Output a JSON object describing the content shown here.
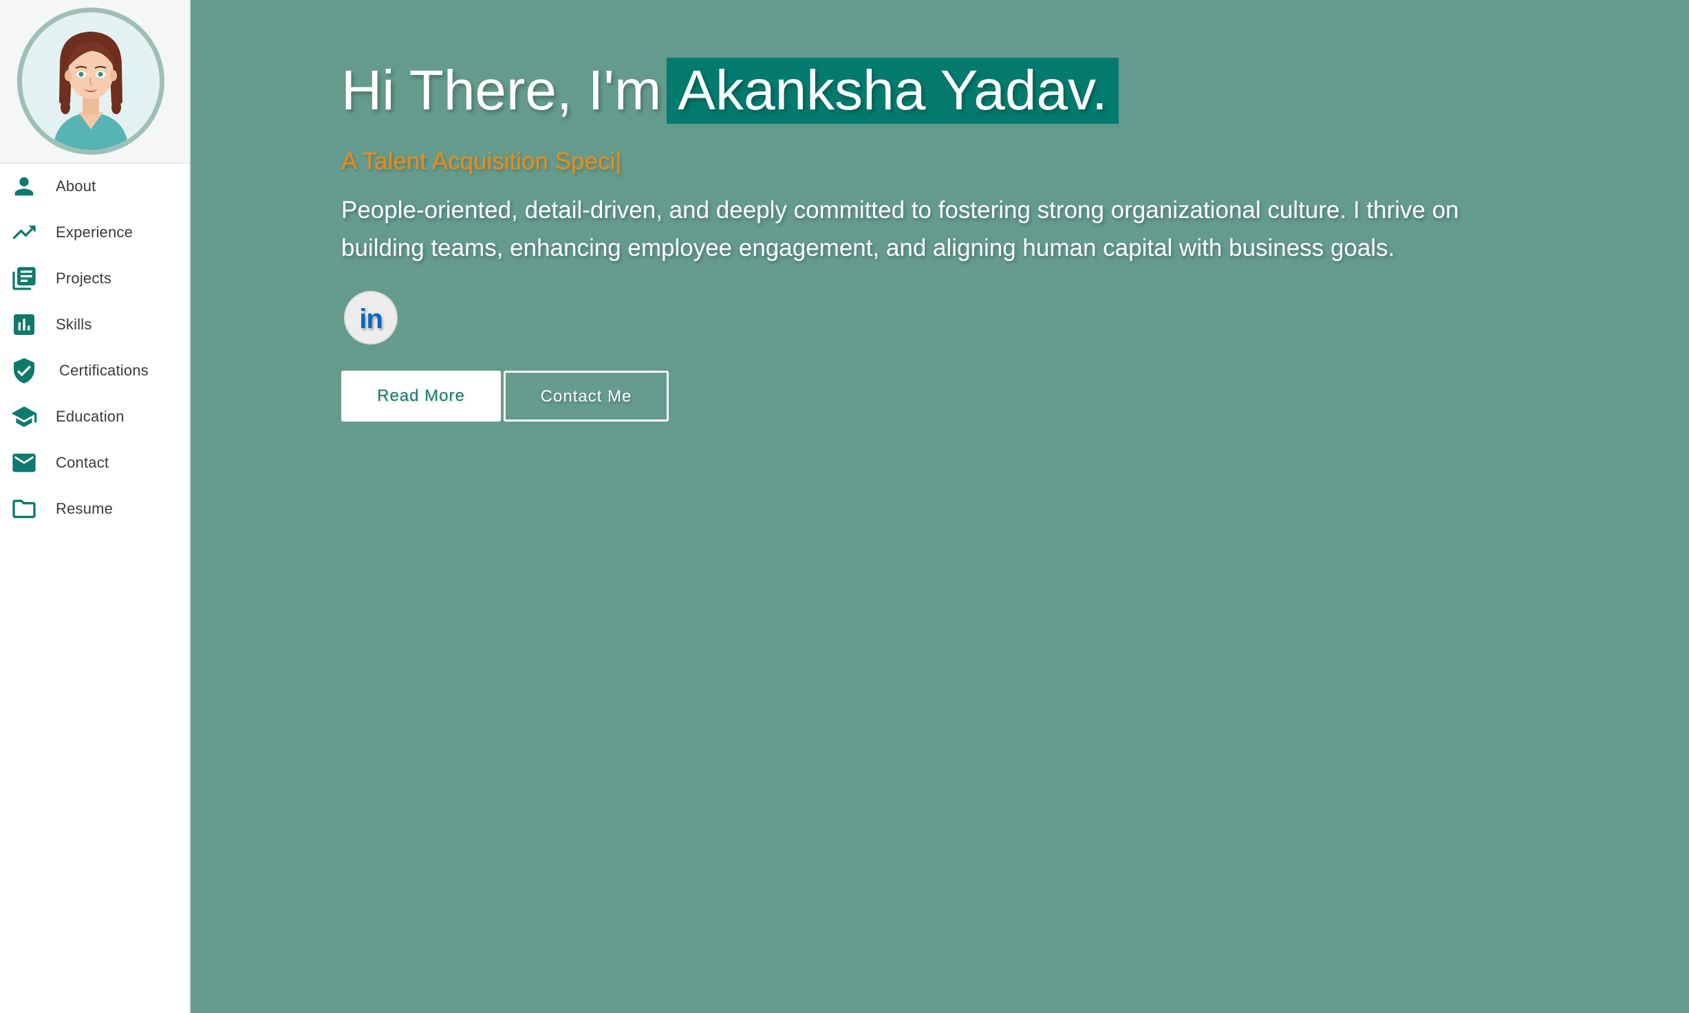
{
  "theme": {
    "accent": "#027b6e",
    "background": "#649b8d",
    "subtitle_color": "#f08a12",
    "sidebar_bg": "#ffffff"
  },
  "profile": {
    "avatar": "woman-avatar-illustration"
  },
  "sidebar": {
    "items": [
      {
        "label": "About",
        "icon": "person-icon"
      },
      {
        "label": "Experience",
        "icon": "trending-up-icon"
      },
      {
        "label": "Projects",
        "icon": "library-books-icon"
      },
      {
        "label": "Skills",
        "icon": "bar-chart-icon"
      },
      {
        "label": "Certifications",
        "icon": "verified-shield-icon"
      },
      {
        "label": "Education",
        "icon": "graduation-cap-icon"
      },
      {
        "label": "Contact",
        "icon": "mail-icon"
      },
      {
        "label": "Resume",
        "icon": "folder-icon"
      }
    ]
  },
  "hero": {
    "greeting": "Hi There, I'm",
    "name": "Akanksha Yadav.",
    "typed_subtitle": "A Talent Acquisition Speci|",
    "bio": "People-oriented, detail-driven, and deeply committed to fostering strong organizational culture. I thrive on building teams, enhancing employee engagement, and aligning human capital with business goals.",
    "social": [
      {
        "icon": "linkedin-icon",
        "glyph": "in"
      }
    ],
    "buttons": {
      "read_more": "Read More",
      "contact_me": "Contact Me"
    }
  }
}
